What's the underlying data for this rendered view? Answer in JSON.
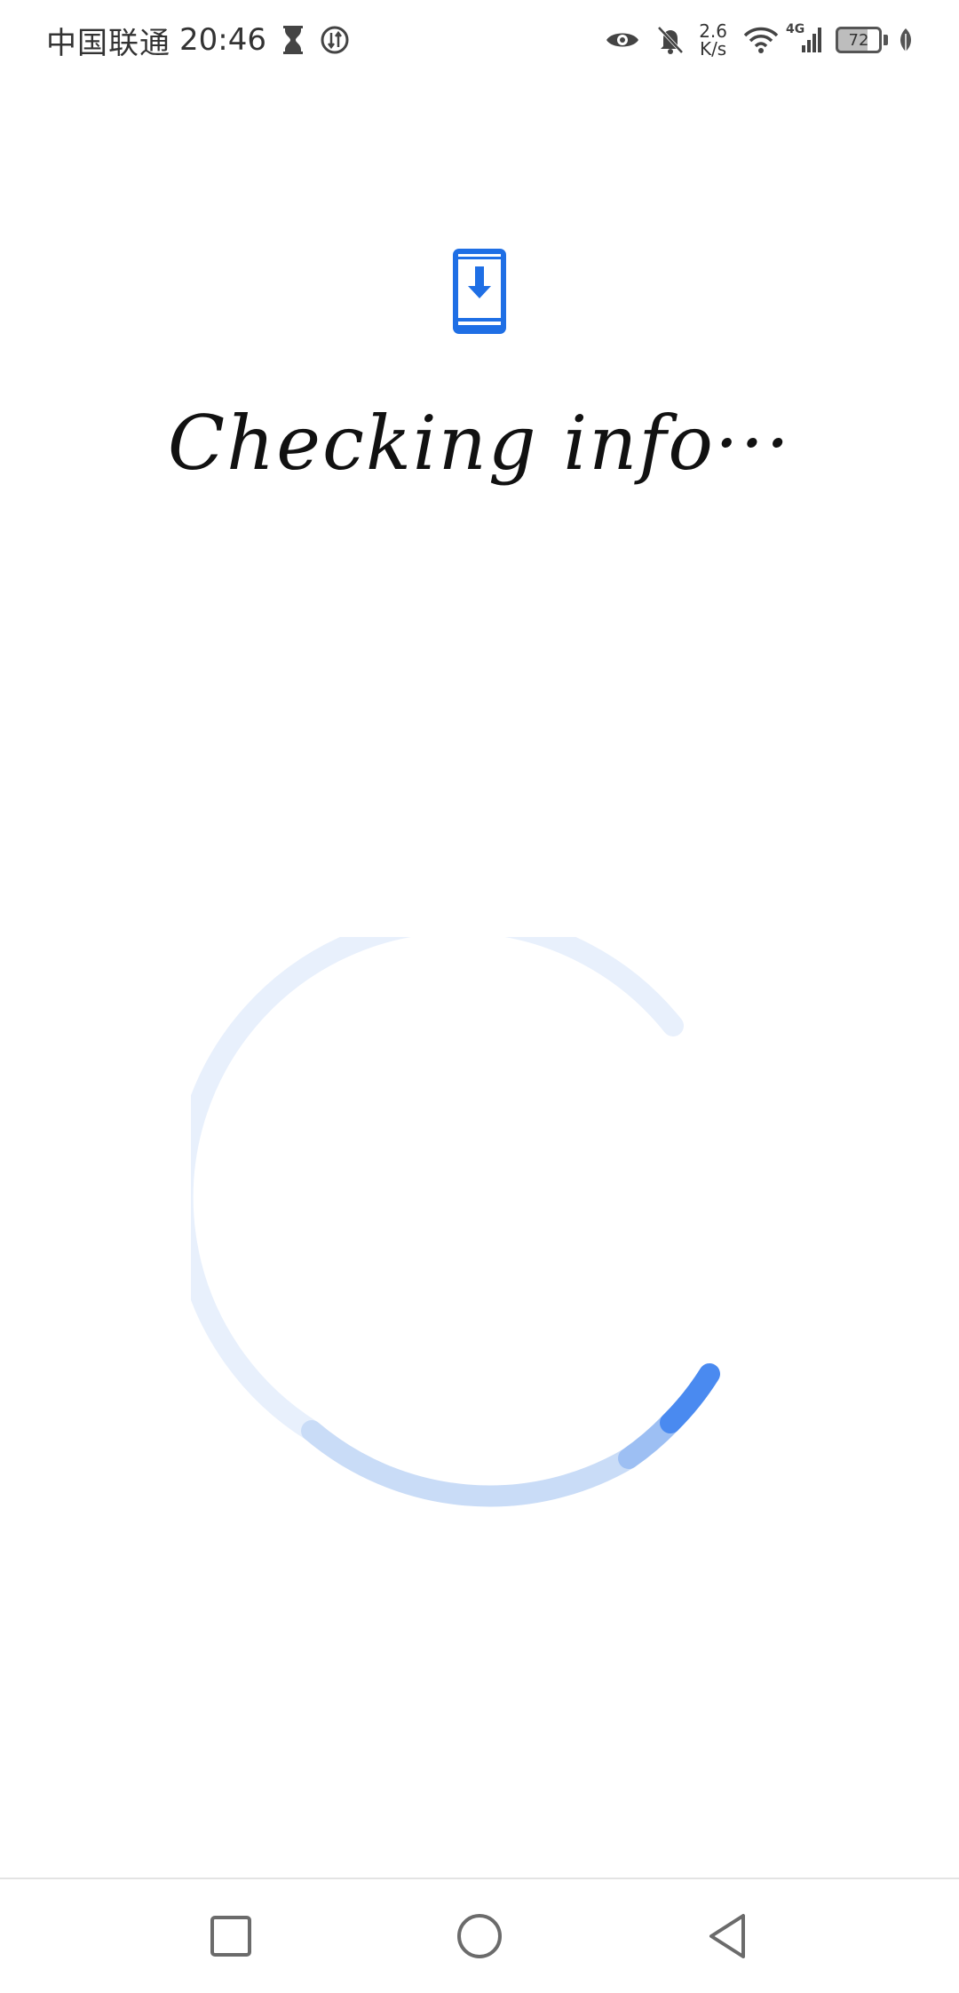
{
  "status_bar": {
    "carrier": "中国联通",
    "time": "20:46",
    "net_speed_value": "2.6",
    "net_speed_unit": "K/s",
    "network_type": "4G",
    "battery_level": "72",
    "icons": [
      "hourglass-icon",
      "data-saver-icon",
      "eye-icon",
      "bell-off-icon",
      "wifi-icon",
      "signal-icon",
      "battery-icon",
      "leaf-icon"
    ]
  },
  "main": {
    "top_icon": "phone-download-icon",
    "title": "Checking info···",
    "spinner": {
      "icon": "loading-spinner"
    }
  },
  "nav_bar": {
    "buttons": [
      "recents-square-icon",
      "home-circle-icon",
      "back-triangle-icon"
    ]
  },
  "colors": {
    "accent": "#1f6fe5",
    "spinner_track": "#e8f0fc",
    "spinner_mid": "#c9dcf7",
    "spinner_head": "#4a8af0",
    "nav_icon": "#6b6b6b"
  }
}
